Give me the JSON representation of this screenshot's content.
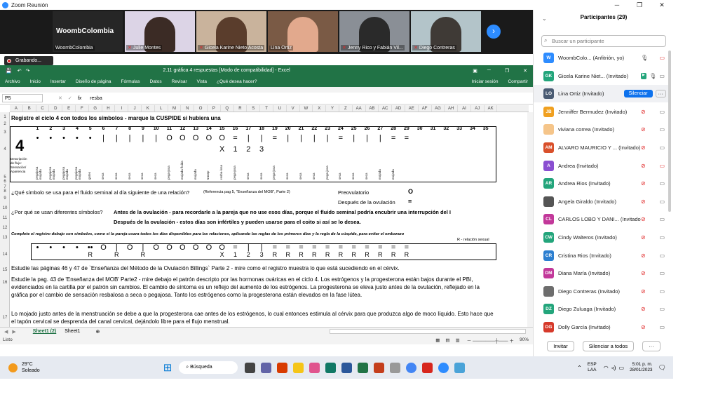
{
  "zoom": {
    "title": "Zoom Reunión",
    "recording": "Grabando...",
    "host_label": "WoombColombia",
    "host_name": "WoombColombia"
  },
  "videos": [
    {
      "name": "Julie Montes"
    },
    {
      "name": "Gicela Karine Nieto Acosta"
    },
    {
      "name": "Lina Ortiz"
    },
    {
      "name": "Jenny Rico y Fabián Vil..."
    },
    {
      "name": "Diego Contreras"
    }
  ],
  "excel": {
    "title": "2.11 gráfica 4 respuestas  [Modo de compatibilidad] - Excel",
    "tabs": [
      "Archivo",
      "Inicio",
      "Insertar",
      "Diseño de página",
      "Fórmulas",
      "Datos",
      "Revisar",
      "Vista"
    ],
    "tell_me": "¿Qué desea hacer?",
    "signin": "Iniciar sesión",
    "share": "Compartir",
    "namebox": "P5",
    "formula": "resba",
    "fx": "fx",
    "sheets": [
      "Sheet1 (2)",
      "Sheet1"
    ],
    "status": "Listo",
    "zoom": "90%"
  },
  "columns": [
    "A",
    "B",
    "C",
    "D",
    "E",
    "F",
    "G",
    "H",
    "I",
    "J",
    "K",
    "L",
    "M",
    "N",
    "O",
    "P",
    "Q",
    "R",
    "S",
    "T",
    "U",
    "V",
    "W",
    "X",
    "Y",
    "Z",
    "AA",
    "AB",
    "AC",
    "AD",
    "AE",
    "AF",
    "AG",
    "AH",
    "AI",
    "AJ",
    "AK"
  ],
  "rows": [
    "1",
    "2",
    "3",
    "4",
    "5",
    "6",
    "7",
    "8",
    "9",
    "10",
    "11",
    "12",
    "13",
    "14",
    "15",
    "16",
    "17"
  ],
  "sheet": {
    "r1": "Registre el ciclo 4 con todos los símbolos   -   marque la CUSPIDE si hubiera una",
    "big4": "4",
    "day_nums": [
      "1",
      "2",
      "3",
      "4",
      "5",
      "6",
      "7",
      "8",
      "9",
      "10",
      "11",
      "12",
      "13",
      "14",
      "15",
      "16",
      "17",
      "18",
      "19",
      "20",
      "21",
      "22",
      "23",
      "24",
      "25",
      "26",
      "27",
      "28",
      "29",
      "30",
      "31",
      "32",
      "33",
      "34",
      "35"
    ],
    "syms": [
      "•",
      "•",
      "•",
      "•",
      "•",
      "|",
      "|",
      "|",
      "|",
      "|",
      "O",
      "O",
      "O",
      "O",
      "O",
      "=",
      "|",
      "|",
      "=",
      "|",
      "|",
      "|",
      "|",
      "=",
      "|",
      "|",
      "|",
      "=",
      "="
    ],
    "sub4": [
      "X",
      "1",
      "2",
      "3"
    ],
    "desc_label": "Descripción de flujo: Sensación/ Apariencia",
    "descs": [
      "pegajosa mojada",
      "pegajosa mojada",
      "pegajosa mojada",
      "pegajosa mojada",
      "goteo",
      "seca",
      "seca",
      "seca",
      "seca",
      "seca",
      "pega-josa",
      "mojada fluida",
      "mojada",
      "transp",
      "resba-losa",
      "pega-josa",
      "seca",
      "seca",
      "pega-josa",
      "seca",
      "seca",
      "seca",
      "pega-josa",
      "seca",
      "seca",
      "seca",
      "mojada",
      "mojada"
    ],
    "r9": "¿Qué símbolo se usa para el fluido seminal al día siguiente de una relación?",
    "r9ref": "(Referencia pag 5, \"Enseñanza del MOB\", Parte 2)",
    "preov": "Preovulatorio",
    "preov_v": "O",
    "postov": "Después de la ovulación",
    "postov_v": "=",
    "r11q": "¿Por qué se usan diferentes símbolos?",
    "r11a": "Antes de la ovulación - para recordarle a la pareja que no use esos días, porque el fluido seminal podría encubrir una interrupción del I",
    "r12a": "Después de la ovulación - estos días son infértiles y pueden usarse para el coito si así se lo desea.",
    "r13": "Complete el registro debajo con símbolos, como si la pareja usara todos los días disponibles para las relaciones, aplicando las reglas de los primeros días y la regla de la cúspide, para evitar el embarazo",
    "r13note": "R - relación sexual",
    "r14top": [
      "•",
      "•",
      "•",
      "•",
      "••",
      "O",
      "|",
      "O",
      "|",
      "O",
      "O",
      "O",
      "O",
      "O",
      "O",
      "=",
      "|",
      "|",
      "=",
      "=",
      "=",
      "=",
      "=",
      "=",
      "=",
      "=",
      "=",
      "=",
      "="
    ],
    "r14bot": [
      "",
      "",
      "",
      "",
      "R",
      "",
      "R",
      "",
      "R",
      "",
      "",
      "",
      "",
      "",
      "X",
      "1",
      "2",
      "3",
      "R",
      "R",
      "R",
      "R",
      "R",
      "R",
      "R",
      "R",
      "R",
      "R",
      "R"
    ],
    "r15": "Estudie las páginas 46 y 47 de `Enseñanza del Método de la Ovulación Billings` Parte 2     -      mire como el registro muestra lo que está sucediendo en el cérvix.",
    "r16": "Estudie la pag. 43 de 'Enseñanza del MOB' Parte2 - mire debajo el patrón descripto por las hormonas ováricas en el ciclo 4. Los estrógenos y la progesterona están bajos durante el PBI, evidenciados en la cartilla por el patrón sin cambios. El cambio de síntoma es un reflejo del aumento de los estrógenos. La progesterona se eleva justo antes de la ovulación, reflejado en la gráfica por el cambio de sensación resbalosa a seca o pegajosa. Tanto los estrógenos como la progesterona están elevados en la fase lútea.",
    "r17": "Lo mojado justo antes de la menstruación se debe a que la progesterona cae antes de los estrógenos, lo cual entonces estimula al cérvix para que produzca algo de moco líquido. Esto hace que el tapón cervical se desprenda del canal cervical, dejándolo libre para el flujo menstrual."
  },
  "participants": {
    "title": "Participantes (29)",
    "search": "Buscar un participante",
    "mute_label": "Silenciar",
    "invite": "Invitar",
    "mute_all": "Silenciar a todos",
    "list": [
      {
        "initials": "W",
        "color": "#2d8cff",
        "name": "WoombColo... (Anfitrión, yo)"
      },
      {
        "initials": "GK",
        "color": "#23a57b",
        "name": "Gicela Karine Niet... (Invitado)"
      },
      {
        "initials": "LO",
        "color": "#4a5b73",
        "name": "Lina Ortiz (Invitado)"
      },
      {
        "initials": "JB",
        "color": "#f0a020",
        "name": "Jenniffer Bermudez (Invitado)"
      },
      {
        "initials": "",
        "color": "#f5c58a",
        "name": "viviana correa (Invitado)"
      },
      {
        "initials": "AM",
        "color": "#d9502b",
        "name": "ALVARO MAURICIO Y ... (Invitado)"
      },
      {
        "initials": "A",
        "color": "#8a4fd1",
        "name": "Andrea (Invitado)"
      },
      {
        "initials": "AR",
        "color": "#23a57b",
        "name": "Andrea Rios (Invitado)"
      },
      {
        "initials": "",
        "color": "#555555",
        "name": "Angela Giraldo (Invitado)"
      },
      {
        "initials": "CL",
        "color": "#c2389a",
        "name": "CARLOS LOBO Y DANI... (Invitado)"
      },
      {
        "initials": "CW",
        "color": "#23a57b",
        "name": "Cindy Walteros (Invitado)"
      },
      {
        "initials": "CR",
        "color": "#2d7fd0",
        "name": "Cristina Rios (Invitado)"
      },
      {
        "initials": "DM",
        "color": "#c2389a",
        "name": "Diana María (Invitado)"
      },
      {
        "initials": "",
        "color": "#6d6d6d",
        "name": "Diego Contreras (Invitado)"
      },
      {
        "initials": "DZ",
        "color": "#23a57b",
        "name": "Diego Zuluaga (Invitado)"
      },
      {
        "initials": "DG",
        "color": "#d63a2b",
        "name": "Dolly García (Invitado)"
      }
    ]
  },
  "taskbar": {
    "temp": "29°C",
    "weather": "Soleado",
    "search": "Búsqueda",
    "lang1": "ESP",
    "lang2": "LAA",
    "time": "5:01 p. m.",
    "date": "28/01/2023"
  }
}
